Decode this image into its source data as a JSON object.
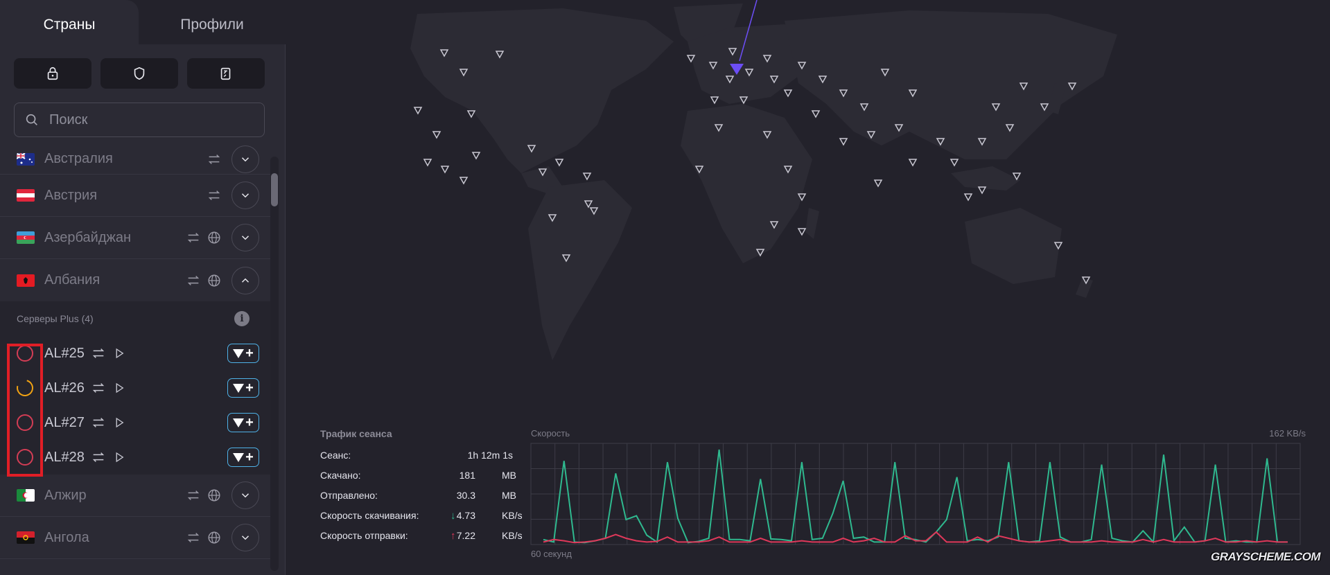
{
  "tabs": {
    "countries": "Страны",
    "profiles": "Профили"
  },
  "search": {
    "placeholder": "Поиск"
  },
  "countries": [
    {
      "name": "Австралия"
    },
    {
      "name": "Австрия"
    },
    {
      "name": "Азербайджан"
    },
    {
      "name": "Албания"
    }
  ],
  "albania": {
    "group_label": "Серверы Plus (4)",
    "info": "i",
    "servers": [
      {
        "name": "AL#25",
        "status": "red"
      },
      {
        "name": "AL#26",
        "status": "busy"
      },
      {
        "name": "AL#27",
        "status": "red"
      },
      {
        "name": "AL#28",
        "status": "red"
      }
    ]
  },
  "countries_after": [
    {
      "name": "Алжир"
    },
    {
      "name": "Ангола"
    }
  ],
  "stats": {
    "title": "Трафик сеанса",
    "session_label": "Сеанс:",
    "session_value": "1h 12m 1s",
    "down_label": "Скачано:",
    "down_value": "181",
    "down_unit": "MB",
    "up_label": "Отправлено:",
    "up_value": "30.3",
    "up_unit": "MB",
    "dspeed_label": "Скорость скачивания:",
    "dspeed_value": "4.73",
    "dspeed_unit": "KB/s",
    "uspeed_label": "Скорость отправки:",
    "uspeed_value": "7.22",
    "uspeed_unit": "KB/s",
    "arrow_down": "↓",
    "arrow_up": "↑"
  },
  "chart_labels": {
    "speed": "Скорость",
    "max": "162  KB/s",
    "window": "60 секунд"
  },
  "watermark": "GRAYSCHEME.COM",
  "colors": {
    "accent": "#6c4ef6",
    "download": "#2fb98f",
    "upload": "#e0385a",
    "busy": "#f2a313",
    "plus_border": "#4fb2e8"
  },
  "chart_data": {
    "type": "line",
    "ylim": [
      0,
      162
    ],
    "series": [
      {
        "values": [
          8,
          4,
          134,
          4,
          3,
          6,
          10,
          114,
          40,
          46,
          15,
          4,
          132,
          42,
          3,
          5,
          10,
          152,
          8,
          8,
          6,
          105,
          9,
          8,
          6,
          132,
          8,
          10,
          50,
          102,
          10,
          12,
          4,
          4,
          132,
          10,
          8,
          4,
          20,
          40,
          108,
          6,
          8,
          6,
          12,
          132,
          6,
          4,
          6,
          132,
          12,
          4,
          4,
          8,
          128,
          10,
          6,
          4,
          22,
          4,
          144,
          6,
          28,
          4,
          6,
          128,
          4,
          6,
          4,
          4,
          138,
          4,
          4
        ]
      },
      {
        "values": [
          4,
          8,
          6,
          3,
          4,
          6,
          10,
          16,
          10,
          6,
          4,
          5,
          12,
          4,
          4,
          4,
          6,
          12,
          4,
          4,
          4,
          10,
          4,
          4,
          4,
          6,
          4,
          4,
          4,
          10,
          4,
          6,
          10,
          4,
          4,
          14,
          6,
          6,
          20,
          4,
          4,
          4,
          12,
          4,
          14,
          10,
          6,
          4,
          4,
          6,
          8,
          4,
          4,
          4,
          6,
          4,
          4,
          4,
          8,
          4,
          8,
          4,
          4,
          4,
          6,
          10,
          4,
          4,
          6,
          4,
          6,
          4,
          4
        ]
      }
    ]
  }
}
